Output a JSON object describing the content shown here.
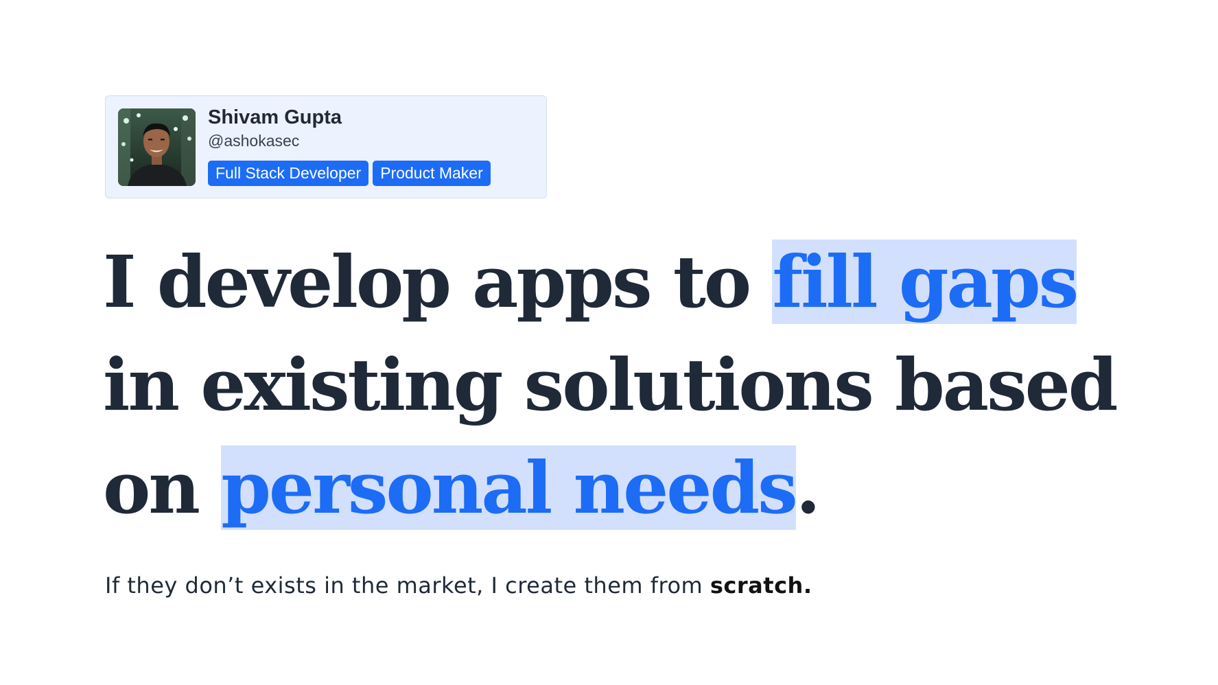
{
  "profile": {
    "name": "Shivam Gupta",
    "handle": "@ashokasec",
    "tags": [
      "Full Stack Developer",
      "Product Maker"
    ]
  },
  "headline": {
    "part1": "I develop apps to ",
    "highlight1": "fill gaps",
    "part2": " in existing solutions based on ",
    "highlight2": "personal needs",
    "part3": "."
  },
  "subtext": {
    "main": "If they don’t exists in the market, I create them from ",
    "emphasis": "scratch."
  },
  "colors": {
    "accent": "#1d6cf5",
    "highlight_bg": "#d2e0fd",
    "card_bg": "#ecf2fe",
    "text_dark": "#1f2937"
  }
}
